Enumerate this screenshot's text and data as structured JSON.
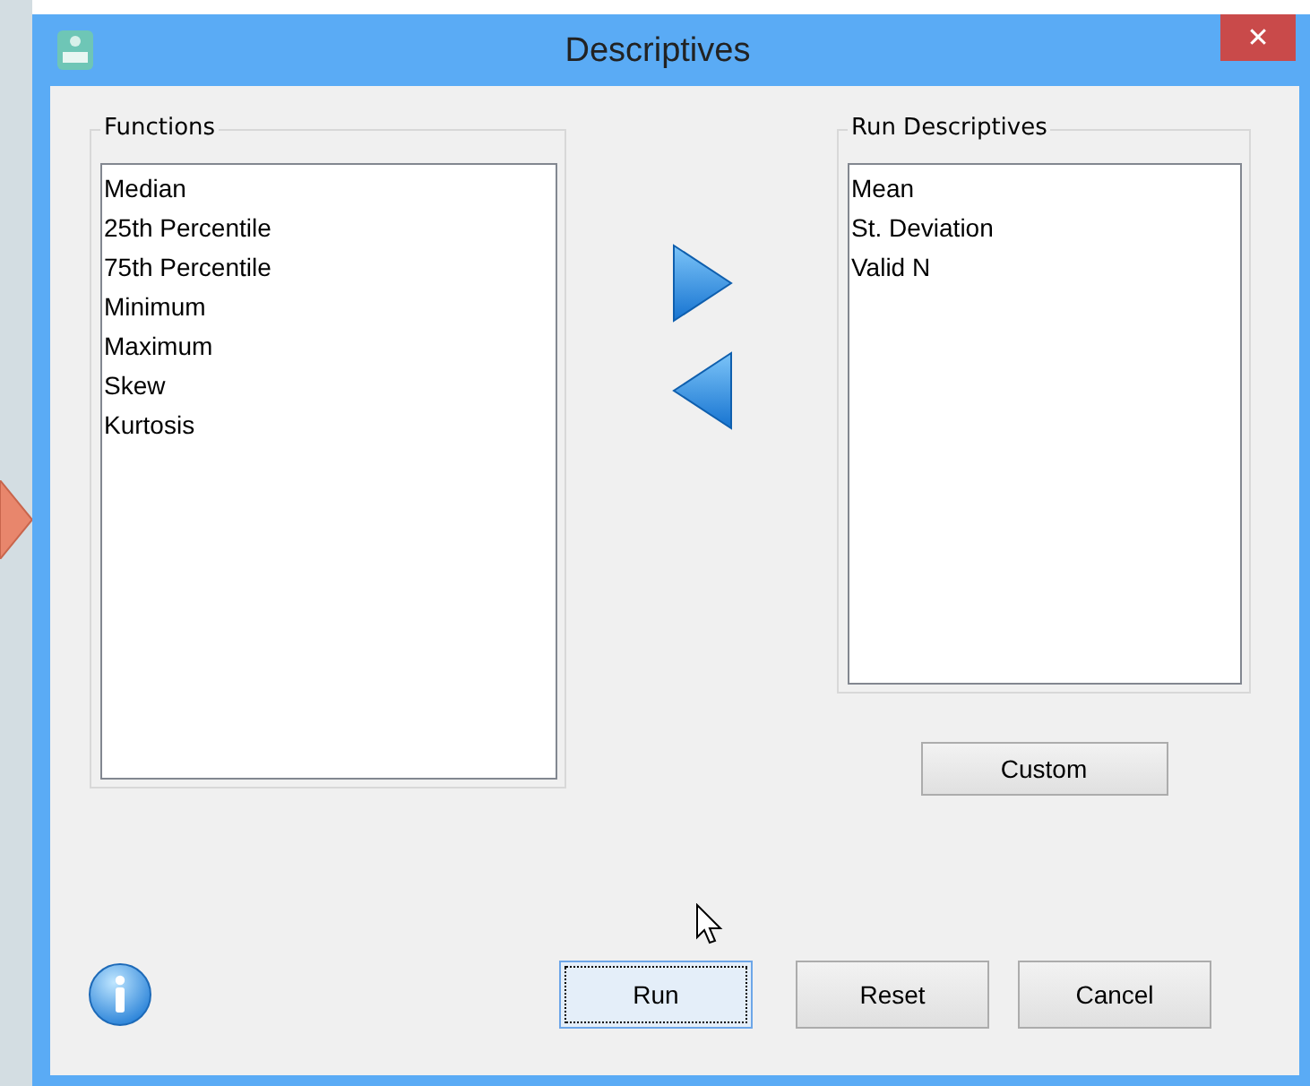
{
  "window": {
    "title": "Descriptives",
    "close": "✕"
  },
  "functions": {
    "title": "Functions",
    "items": [
      "Median",
      "25th Percentile",
      "75th Percentile",
      "Minimum",
      "Maximum",
      "Skew",
      "Kurtosis"
    ]
  },
  "run_descriptives": {
    "title": "Run Descriptives",
    "items": [
      "Mean",
      "St. Deviation",
      "Valid N"
    ]
  },
  "custom_button": "Custom",
  "buttons": [
    {
      "label": "Run",
      "focused": true
    },
    {
      "label": "Reset",
      "focused": false
    },
    {
      "label": "Cancel",
      "focused": false
    }
  ]
}
